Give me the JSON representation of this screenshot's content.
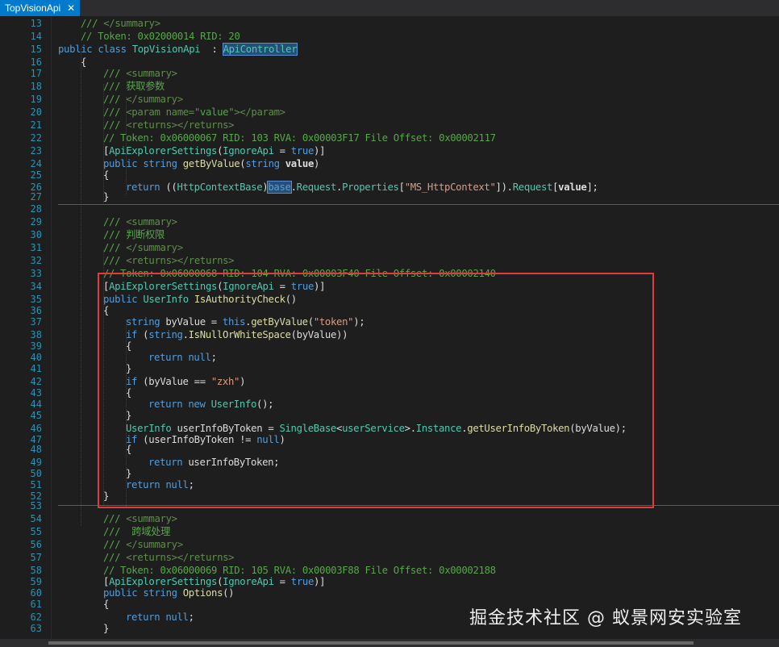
{
  "tab": {
    "title": "TopVisionApi",
    "close_glyph": "✕"
  },
  "lines": [
    {
      "n": "13",
      "segs": [
        [
          "c",
          "/// "
        ],
        [
          "xml",
          "</summary>"
        ]
      ]
    },
    {
      "n": "14",
      "segs": [
        [
          "c",
          "// Token: 0x02000014 RID: 20"
        ]
      ]
    },
    {
      "n": "15",
      "segs": [
        [
          "k",
          "public class "
        ],
        [
          "t",
          "TopVisionApi"
        ],
        [
          "",
          "  : "
        ],
        [
          "t hl",
          "ApiController"
        ]
      ]
    },
    {
      "n": "16",
      "segs": [
        [
          "",
          "{"
        ]
      ]
    },
    {
      "n": "17",
      "segs": [
        [
          "c",
          "/// "
        ],
        [
          "xml",
          "<summary>"
        ]
      ]
    },
    {
      "n": "18",
      "segs": [
        [
          "c",
          "/// 获取参数"
        ]
      ]
    },
    {
      "n": "19",
      "segs": [
        [
          "c",
          "/// "
        ],
        [
          "xml",
          "</summary>"
        ]
      ]
    },
    {
      "n": "20",
      "segs": [
        [
          "c",
          "/// "
        ],
        [
          "xml",
          "<param name=\""
        ],
        [
          "c",
          "value"
        ],
        [
          "xml",
          "\"></param>"
        ]
      ]
    },
    {
      "n": "21",
      "segs": [
        [
          "c",
          "/// "
        ],
        [
          "xml",
          "<returns></returns>"
        ]
      ]
    },
    {
      "n": "22",
      "segs": [
        [
          "c",
          "// Token: 0x06000067 RID: 103 RVA: 0x00003F17 File Offset: 0x00002117"
        ]
      ]
    },
    {
      "n": "23",
      "segs": [
        [
          "",
          "["
        ],
        [
          "t",
          "ApiExplorerSettings"
        ],
        [
          "",
          "("
        ],
        [
          "t",
          "IgnoreApi"
        ],
        [
          "",
          " = "
        ],
        [
          "k",
          "true"
        ],
        [
          "",
          ")]"
        ]
      ]
    },
    {
      "n": "24",
      "segs": [
        [
          "k",
          "public string "
        ],
        [
          "f",
          "getByValue"
        ],
        [
          "",
          "("
        ],
        [
          "k",
          "string "
        ],
        [
          "b",
          "value"
        ],
        [
          "",
          ")"
        ]
      ]
    },
    {
      "n": "25",
      "segs": [
        [
          "",
          "{"
        ]
      ]
    },
    {
      "n": "26",
      "segs": [
        [
          "k",
          "return "
        ],
        [
          "",
          "(("
        ],
        [
          "t",
          "HttpContextBase"
        ],
        [
          "",
          ")"
        ],
        [
          "k hl",
          "base"
        ],
        [
          "",
          "."
        ],
        [
          "t",
          "Request"
        ],
        [
          "",
          "."
        ],
        [
          "t",
          "Properties"
        ],
        [
          "",
          "["
        ],
        [
          "s",
          "\"MS_HttpContext\""
        ],
        [
          "",
          "])."
        ],
        [
          "t",
          "Request"
        ],
        [
          "",
          "["
        ],
        [
          "b",
          "value"
        ],
        [
          "",
          "];"
        ]
      ]
    },
    {
      "n": "27",
      "segs": [
        [
          "",
          "}"
        ]
      ]
    },
    {
      "n": "28",
      "segs": []
    },
    {
      "n": "29",
      "segs": [
        [
          "c",
          "/// "
        ],
        [
          "xml",
          "<summary>"
        ]
      ]
    },
    {
      "n": "30",
      "segs": [
        [
          "c",
          "/// 判断权限"
        ]
      ]
    },
    {
      "n": "31",
      "segs": [
        [
          "c",
          "/// "
        ],
        [
          "xml",
          "</summary>"
        ]
      ]
    },
    {
      "n": "32",
      "segs": [
        [
          "c",
          "/// "
        ],
        [
          "xml",
          "<returns></returns>"
        ]
      ]
    },
    {
      "n": "33",
      "segs": [
        [
          "c strike",
          "// Token: 0x06000068 RID: 104 RVA: 0x00003F40 File Offset: 0x00002140"
        ]
      ]
    },
    {
      "n": "34",
      "segs": [
        [
          "",
          "["
        ],
        [
          "t",
          "ApiExplorerSettings"
        ],
        [
          "",
          "("
        ],
        [
          "t",
          "IgnoreApi"
        ],
        [
          "",
          " = "
        ],
        [
          "k",
          "true"
        ],
        [
          "",
          ")]"
        ]
      ]
    },
    {
      "n": "35",
      "segs": [
        [
          "k",
          "public "
        ],
        [
          "t",
          "UserInfo "
        ],
        [
          "f",
          "IsAuthorityCheck"
        ],
        [
          "",
          "()"
        ]
      ]
    },
    {
      "n": "36",
      "segs": [
        [
          "",
          "{"
        ]
      ]
    },
    {
      "n": "37",
      "segs": [
        [
          "k",
          "string "
        ],
        [
          "",
          "byValue = "
        ],
        [
          "k",
          "this"
        ],
        [
          "",
          "."
        ],
        [
          "f",
          "getByValue"
        ],
        [
          "",
          "("
        ],
        [
          "s",
          "\"token\""
        ],
        [
          "",
          ");"
        ]
      ]
    },
    {
      "n": "38",
      "segs": [
        [
          "k",
          "if "
        ],
        [
          "",
          "("
        ],
        [
          "k",
          "string"
        ],
        [
          "",
          "."
        ],
        [
          "f",
          "IsNullOrWhiteSpace"
        ],
        [
          "",
          "(byValue))"
        ]
      ]
    },
    {
      "n": "39",
      "segs": [
        [
          "",
          "{"
        ]
      ]
    },
    {
      "n": "40",
      "segs": [
        [
          "k",
          "return null"
        ],
        [
          "",
          ";"
        ]
      ]
    },
    {
      "n": "41",
      "segs": [
        [
          "",
          "}"
        ]
      ]
    },
    {
      "n": "42",
      "segs": [
        [
          "k",
          "if "
        ],
        [
          "",
          "(byValue == "
        ],
        [
          "s",
          "\"zxh\""
        ],
        [
          "",
          ")"
        ]
      ]
    },
    {
      "n": "43",
      "segs": [
        [
          "",
          "{"
        ]
      ]
    },
    {
      "n": "44",
      "segs": [
        [
          "k",
          "return new "
        ],
        [
          "t",
          "UserInfo"
        ],
        [
          "",
          "();"
        ]
      ]
    },
    {
      "n": "45",
      "segs": [
        [
          "",
          "}"
        ]
      ]
    },
    {
      "n": "46",
      "segs": [
        [
          "t",
          "UserInfo "
        ],
        [
          "",
          "userInfoByToken = "
        ],
        [
          "t",
          "SingleBase"
        ],
        [
          "",
          "<"
        ],
        [
          "t",
          "userService"
        ],
        [
          "",
          ">."
        ],
        [
          "t",
          "Instance"
        ],
        [
          "",
          "."
        ],
        [
          "f",
          "getUserInfoByToken"
        ],
        [
          "",
          "(byValue);"
        ]
      ]
    },
    {
      "n": "47",
      "segs": [
        [
          "k",
          "if "
        ],
        [
          "",
          "(userInfoByToken != "
        ],
        [
          "k",
          "null"
        ],
        [
          "",
          ")"
        ]
      ]
    },
    {
      "n": "48",
      "segs": [
        [
          "",
          "{"
        ]
      ]
    },
    {
      "n": "49",
      "segs": [
        [
          "k",
          "return "
        ],
        [
          "",
          "userInfoByToken;"
        ]
      ]
    },
    {
      "n": "50",
      "segs": [
        [
          "",
          "}"
        ]
      ]
    },
    {
      "n": "51",
      "segs": [
        [
          "k",
          "return null"
        ],
        [
          "",
          ";"
        ]
      ]
    },
    {
      "n": "52",
      "segs": [
        [
          "",
          "}"
        ]
      ]
    },
    {
      "n": "53",
      "segs": []
    },
    {
      "n": "54",
      "segs": [
        [
          "c",
          "/// "
        ],
        [
          "xml",
          "<summary>"
        ]
      ]
    },
    {
      "n": "55",
      "segs": [
        [
          "c",
          "///  跨域处理"
        ]
      ]
    },
    {
      "n": "56",
      "segs": [
        [
          "c",
          "/// "
        ],
        [
          "xml",
          "</summary>"
        ]
      ]
    },
    {
      "n": "57",
      "segs": [
        [
          "c",
          "/// "
        ],
        [
          "xml",
          "<returns></returns>"
        ]
      ]
    },
    {
      "n": "58",
      "segs": [
        [
          "c",
          "// Token: 0x06000069 RID: 105 RVA: 0x00003F88 File Offset: 0x00002188"
        ]
      ]
    },
    {
      "n": "59",
      "segs": [
        [
          "",
          "["
        ],
        [
          "t",
          "ApiExplorerSettings"
        ],
        [
          "",
          "("
        ],
        [
          "t",
          "IgnoreApi"
        ],
        [
          "",
          " = "
        ],
        [
          "k",
          "true"
        ],
        [
          "",
          ")]"
        ]
      ]
    },
    {
      "n": "60",
      "segs": [
        [
          "k",
          "public string "
        ],
        [
          "f",
          "Options"
        ],
        [
          "",
          "()"
        ]
      ]
    },
    {
      "n": "61",
      "segs": [
        [
          "",
          "{"
        ]
      ]
    },
    {
      "n": "62",
      "segs": [
        [
          "k",
          "return null"
        ],
        [
          "",
          ";"
        ]
      ]
    },
    {
      "n": "63",
      "segs": [
        [
          "",
          "}"
        ]
      ]
    }
  ],
  "watermark": "掘金技术社区 @ 蚁景网安实验室"
}
